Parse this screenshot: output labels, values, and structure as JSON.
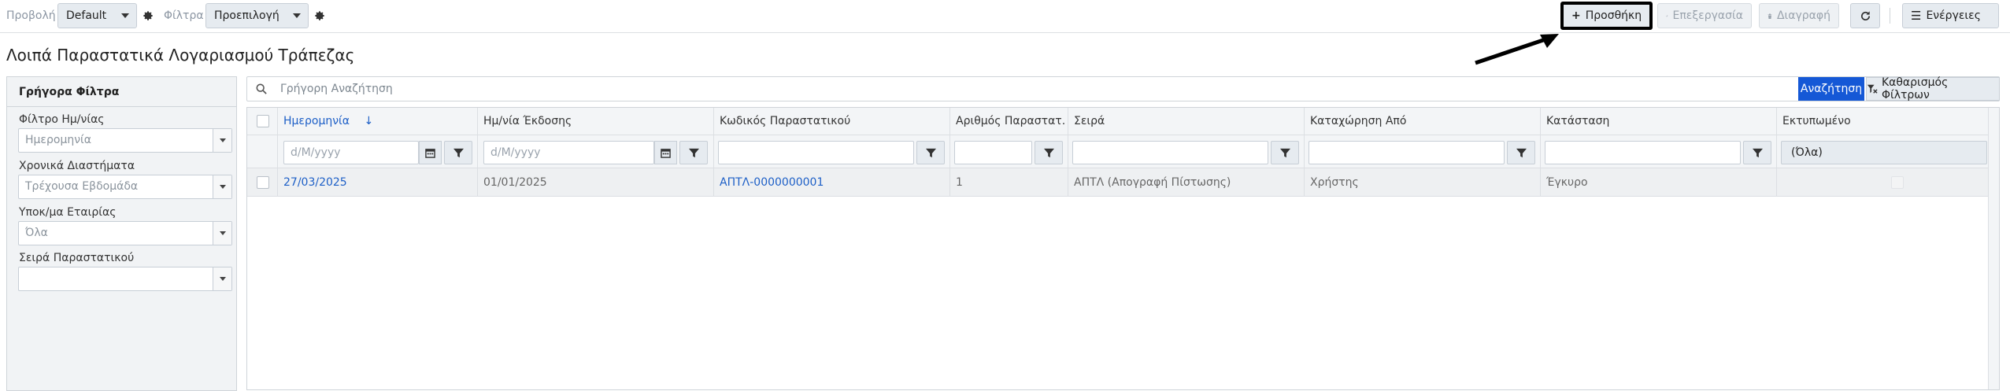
{
  "toolbar": {
    "view_label": "Προβολή",
    "view_value": "Default",
    "filters_label": "Φίλτρα",
    "filters_value": "Προεπιλογή",
    "add_label": "Προσθήκη",
    "edit_label": "Επεξεργασία",
    "delete_label": "Διαγραφή",
    "actions_label": "Ενέργειες"
  },
  "page": {
    "title": "Λοιπά Παραστατικά Λογαριασμού Τράπεζας"
  },
  "quick_filters": {
    "title": "Γρήγορα Φίλτρα",
    "fields": [
      {
        "label": "Φίλτρο Ημ/νίας",
        "value": "Ημερομηνία"
      },
      {
        "label": "Χρονικά Διαστήματα",
        "value": "Τρέχουσα Εβδομάδα"
      },
      {
        "label": "Υποκ/μα Εταιρίας",
        "value": "Όλα"
      },
      {
        "label": "Σειρά Παραστατικού",
        "value": ""
      }
    ]
  },
  "search": {
    "placeholder": "Γρήγορη Αναζήτηση",
    "search_button": "Αναζήτηση",
    "clear_button": "Καθαρισμός Φίλτρων"
  },
  "grid": {
    "columns": [
      "Ημερομηνία",
      "Ημ/νία Έκδοσης",
      "Κωδικός Παραστατικού",
      "Αριθμός Παραστατ...",
      "Σειρά",
      "Καταχώρηση Από",
      "Κατάσταση",
      "Εκτυπωμένο"
    ],
    "date_placeholder": "d/M/yyyy",
    "printed_filter_value": "(Όλα)",
    "rows": [
      {
        "date": "27/03/2025",
        "issue_date": "01/01/2025",
        "code": "ΑΠΤΛ-0000000001",
        "number": "1",
        "series": "ΑΠΤΛ (Απογραφή Πίστωσης)",
        "entered_by": "Χρήστης",
        "status": "Έγκυρο",
        "printed": false
      }
    ]
  },
  "colors": {
    "primary": "#1558d6",
    "link": "#1d5fc7",
    "button_bg": "#e6ebf0",
    "header_bg": "#f3f5f7"
  }
}
